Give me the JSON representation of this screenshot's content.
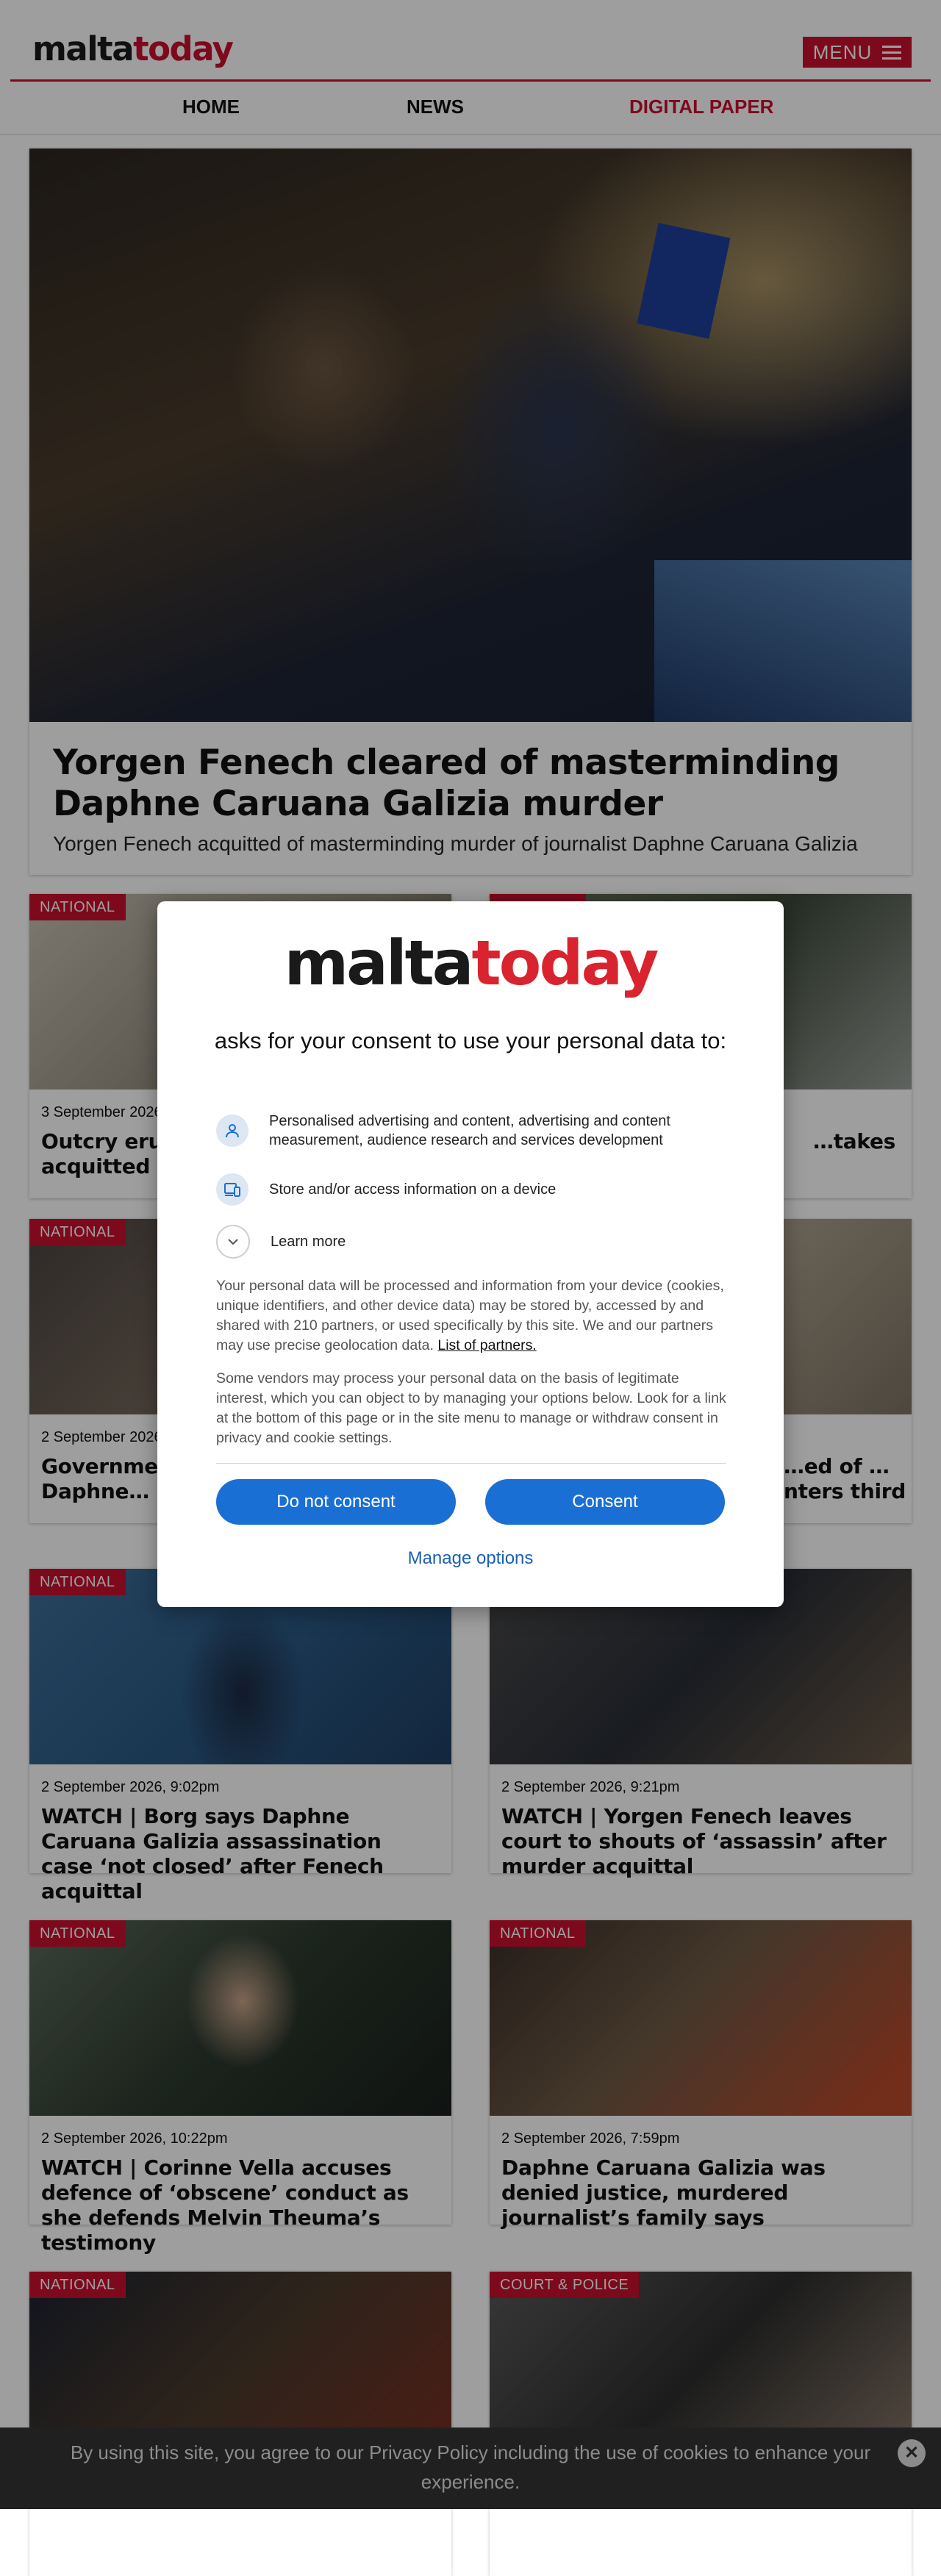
{
  "header": {
    "logo": {
      "part1": "malta",
      "part2": "today"
    },
    "menu_label": "MENU",
    "nav": [
      {
        "label": "HOME"
      },
      {
        "label": "NEWS"
      },
      {
        "label": "DIGITAL PAPER"
      }
    ]
  },
  "hero": {
    "title": "Yorgen Fenech cleared of masterminding Daphne Caruana Galizia murder",
    "subtitle": "Yorgen Fenech acquitted of masterminding murder of journalist Daphne Caruana Galizia"
  },
  "cards": [
    {
      "tag": "NATIONAL",
      "date": "3 September 2026",
      "title": "Outcry erupts after Yorgen Fenech acquitted of murder"
    },
    {
      "tag": "NATIONAL",
      "date": "",
      "title": "…takes"
    },
    {
      "tag": "NATIONAL",
      "date": "2 September 2026",
      "title": "Government… be allowed… after Daphne…"
    },
    {
      "tag": "",
      "date": "",
      "title": "…ed of …nters third"
    },
    {
      "tag": "NATIONAL",
      "date": "2 September 2026, 9:02pm",
      "title": "WATCH | Borg says Daphne Caruana Galizia assassination case ‘not closed’ after Fenech acquittal"
    },
    {
      "tag": "",
      "date": "2 September 2026, 9:21pm",
      "title": "WATCH | Yorgen Fenech leaves court to shouts of ‘assassin’ after murder acquittal"
    },
    {
      "tag": "NATIONAL",
      "date": "2 September 2026, 10:22pm",
      "title": "WATCH | Corinne Vella accuses defence of ‘obscene’ conduct as she defends Melvin Theuma’s testimony"
    },
    {
      "tag": "NATIONAL",
      "date": "2 September 2026, 7:59pm",
      "title": "Daphne Caruana Galizia was denied justice, murdered journalist’s family says"
    },
    {
      "tag": "NATIONAL",
      "date": "",
      "title": ""
    },
    {
      "tag": "COURT & POLICE",
      "date": "",
      "title": ""
    }
  ],
  "consent": {
    "logo": {
      "part1": "malta",
      "part2": "today"
    },
    "heading": "asks for your consent to use your personal data to:",
    "purposes": [
      {
        "icon": "person-icon",
        "label": "Personalised advertising and content, advertising and content measurement, audience research and services development"
      },
      {
        "icon": "device-icon",
        "label": "Store and/or access information on a device"
      },
      {
        "icon": "chevron-down-icon",
        "label": "Learn more"
      }
    ],
    "body1": "Your personal data will be processed and information from your device (cookies, unique identifiers, and other device data) may be stored by, accessed by and shared with 210 partners, or used specifically by this site. We and our partners may use precise geolocation data.",
    "partners_link": "List of partners.",
    "body2": "Some vendors may process your personal data on the basis of legitimate interest, which you can object to by managing your options below. Look for a link at the bottom of this page or in the site menu to manage or withdraw consent in privacy and cookie settings.",
    "do_not_consent": "Do not consent",
    "consent": "Consent",
    "manage": "Manage options"
  },
  "cookie_bar": {
    "message": "By using this site, you agree to our Privacy Policy including the use of cookies to enhance your experience."
  },
  "colors": {
    "brand_red": "#c8102e",
    "consent_blue": "#1a6fd4"
  }
}
